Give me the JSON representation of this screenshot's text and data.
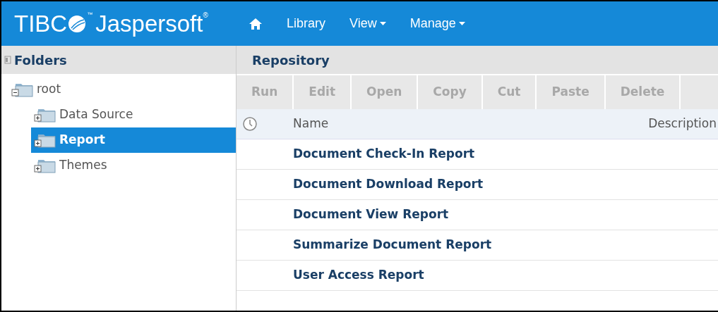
{
  "logo": {
    "prefix": "TIBC",
    "trademark": "™",
    "name": "Jaspersoft",
    "registered": "®"
  },
  "nav": [
    {
      "kind": "home"
    },
    {
      "kind": "link",
      "label": "Library",
      "has_menu": false
    },
    {
      "kind": "link",
      "label": "View",
      "has_menu": true
    },
    {
      "kind": "link",
      "label": "Manage",
      "has_menu": true
    }
  ],
  "folders": {
    "title": "Folders",
    "tree": [
      {
        "label": "root",
        "expanded": true,
        "selected": false,
        "children": [
          {
            "label": "Data Source",
            "expanded": false,
            "selected": false
          },
          {
            "label": "Report",
            "expanded": false,
            "selected": true
          },
          {
            "label": "Themes",
            "expanded": false,
            "selected": false
          }
        ]
      }
    ]
  },
  "repository": {
    "title": "Repository",
    "toolbar": [
      {
        "label": "Run",
        "disabled": true
      },
      {
        "label": "Edit",
        "disabled": true
      },
      {
        "label": "Open",
        "disabled": true
      },
      {
        "label": "Copy",
        "disabled": true
      },
      {
        "label": "Cut",
        "disabled": true
      },
      {
        "label": "Paste",
        "disabled": true
      },
      {
        "label": "Delete",
        "disabled": true
      }
    ],
    "columns": [
      "Name",
      "Description"
    ],
    "rows": [
      {
        "name": "Document Check-In Report"
      },
      {
        "name": "Document Download Report"
      },
      {
        "name": "Document View Report"
      },
      {
        "name": "Summarize Document Report"
      },
      {
        "name": "User Access Report"
      }
    ]
  }
}
